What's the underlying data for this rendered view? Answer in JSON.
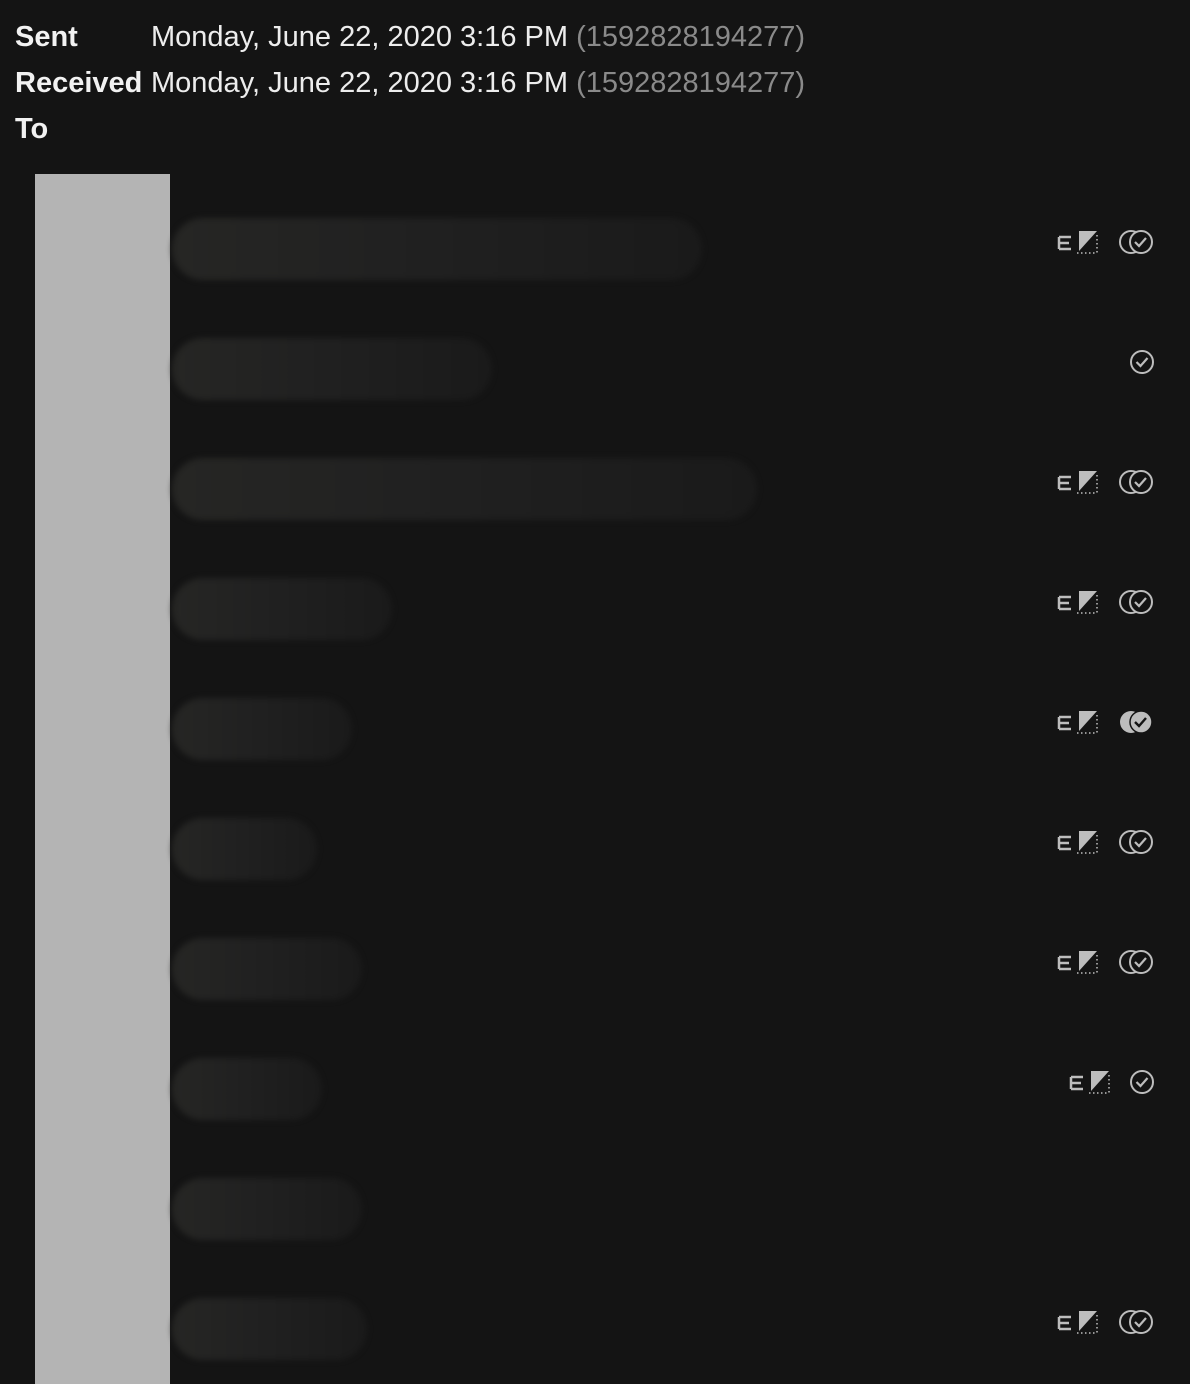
{
  "header": {
    "sent_label": "Sent",
    "sent_value": "Monday, June 22, 2020 3:16 PM",
    "sent_timestamp": "(1592828194277)",
    "received_label": "Received",
    "received_value": "Monday, June 22, 2020 3:16 PM",
    "received_timestamp": "(1592828194277)",
    "to_label": "To"
  },
  "recipients": [
    {
      "icons": [
        "email-delivered-icon",
        "read-double-check-icon"
      ],
      "blur_width": 530
    },
    {
      "icons": [
        "single-check-icon"
      ],
      "blur_width": 320
    },
    {
      "icons": [
        "email-delivered-icon",
        "read-double-check-icon"
      ],
      "blur_width": 585
    },
    {
      "icons": [
        "email-delivered-icon",
        "read-double-check-icon"
      ],
      "blur_width": 220
    },
    {
      "icons": [
        "email-delivered-icon",
        "read-double-check-filled-icon"
      ],
      "blur_width": 180
    },
    {
      "icons": [
        "email-delivered-icon",
        "read-double-check-icon"
      ],
      "blur_width": 145
    },
    {
      "icons": [
        "email-delivered-icon",
        "read-double-check-icon"
      ],
      "blur_width": 190
    },
    {
      "icons": [
        "email-delivered-icon",
        "single-check-icon"
      ],
      "blur_width": 150
    },
    {
      "icons": [],
      "blur_width": 190
    },
    {
      "icons": [
        "email-delivered-icon",
        "read-double-check-icon"
      ],
      "blur_width": 195
    }
  ],
  "colors": {
    "background": "#141414",
    "avatar_strip": "#b4b4b4",
    "icon": "#bdbdbd",
    "timestamp": "#8a8a8a"
  }
}
